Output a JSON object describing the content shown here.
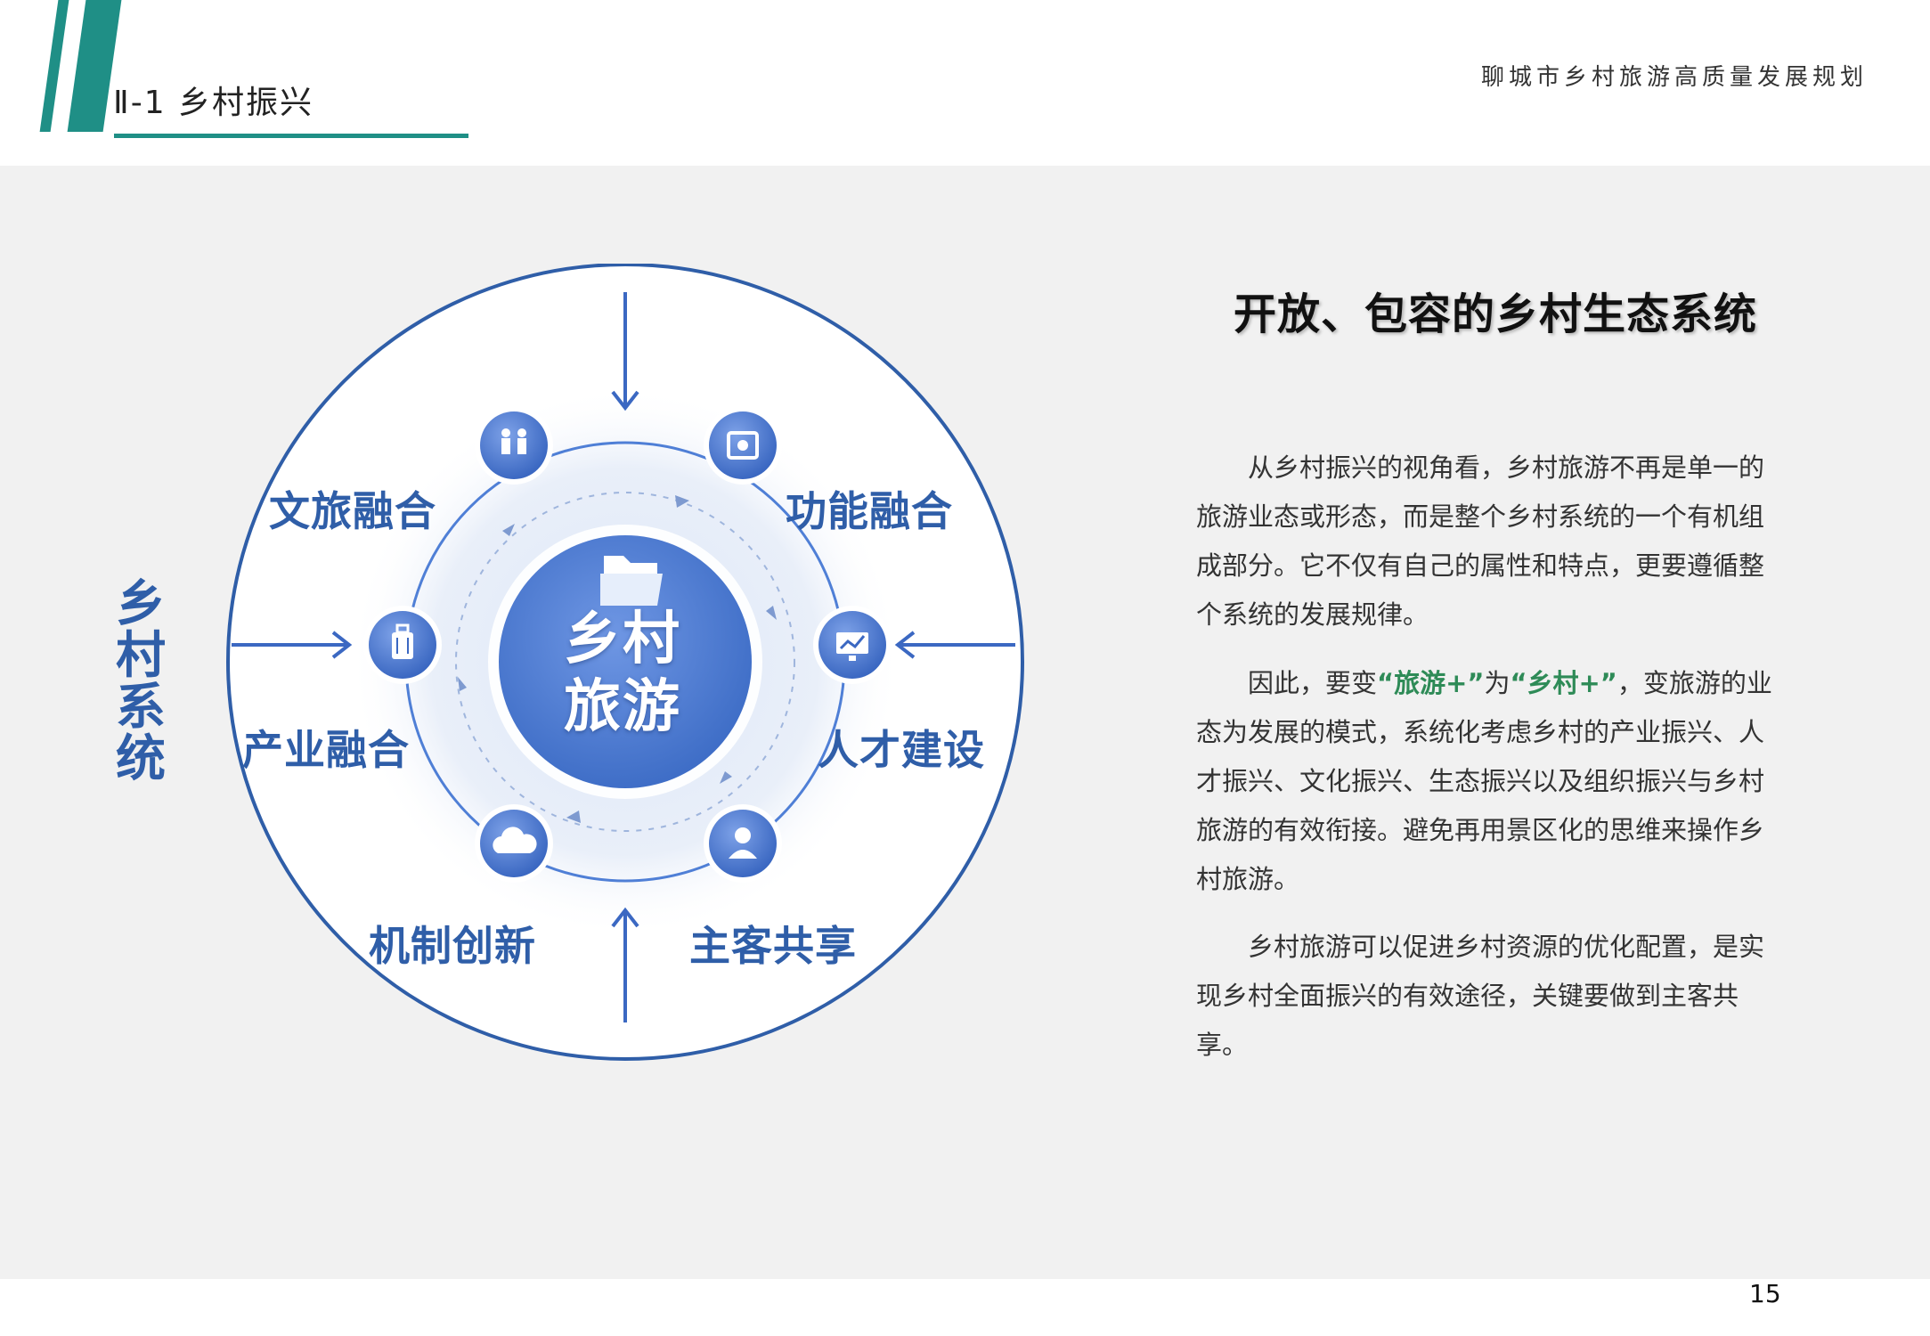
{
  "header": {
    "section_title": "Ⅱ-1  乡村振兴",
    "document_title": "聊城市乡村旅游高质量发展规划"
  },
  "diagram": {
    "vertical_label": "乡村系统",
    "center": {
      "line1": "乡村",
      "line2": "旅游",
      "icon": "folder-icon"
    },
    "labels": {
      "top_left": "文旅融合",
      "top_right": "功能融合",
      "middle_left": "产业融合",
      "middle_right": "人才建设",
      "bottom_left": "机制创新",
      "bottom_right": "主客共享"
    },
    "nodes": [
      {
        "icon": "people-icon"
      },
      {
        "icon": "picture-icon"
      },
      {
        "icon": "chart-monitor-icon"
      },
      {
        "icon": "user-icon"
      },
      {
        "icon": "cloud-icon"
      },
      {
        "icon": "luggage-icon"
      }
    ],
    "colors": {
      "primary": "#2f5ea8",
      "node": "#4a78d0",
      "center": "#4f7fd6"
    }
  },
  "panel": {
    "heading": "开放、包容的乡村生态系统",
    "p1": "从乡村振兴的视角看，乡村旅游不再是单一的旅游业态或形态，而是整个乡村系统的一个有机组成部分。它不仅有自己的属性和特点，更要遵循整个系统的发展规律。",
    "p2_a": "因此，要变",
    "p2_hl1": "“旅游+”",
    "p2_b": "为",
    "p2_hl2": "“乡村+”",
    "p2_c": "，变旅游的业态为发展的模式，系统化考虑乡村的产业振兴、人才振兴、文化振兴、生态振兴以及组织振兴与乡村旅游的有效衔接。避免再用景区化的思维来操作乡村旅游。",
    "p3": "乡村旅游可以促进乡村资源的优化配置，是实现乡村全面振兴的有效途径，关键要做到主客共享。",
    "highlight_color": "#2e8b57"
  },
  "footer": {
    "page_number": "15"
  }
}
